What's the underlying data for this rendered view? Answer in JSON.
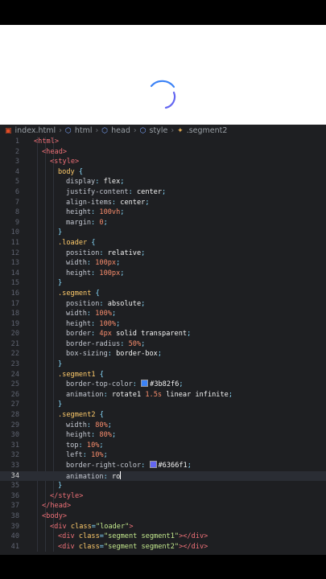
{
  "preview": {
    "spinner_color_1": "#3b82f6",
    "spinner_color_2": "#6366f1"
  },
  "breadcrumb": [
    {
      "label": "index.html",
      "icon": "html5-icon"
    },
    {
      "label": "html",
      "icon": "element-icon"
    },
    {
      "label": "head",
      "icon": "element-icon"
    },
    {
      "label": "style",
      "icon": "element-icon"
    },
    {
      "label": ".segment2",
      "icon": "css-rule-icon"
    }
  ],
  "active_line": 34,
  "lines": [
    {
      "n": "1",
      "code": [
        [
          "tag",
          "<html>"
        ]
      ],
      "indent": 0
    },
    {
      "n": "2",
      "code": [
        [
          "tag",
          "<head>"
        ]
      ],
      "indent": 1
    },
    {
      "n": "3",
      "code": [
        [
          "tag",
          "<style>"
        ]
      ],
      "indent": 2
    },
    {
      "n": "4",
      "code": [
        [
          "sel",
          "body "
        ],
        [
          "punc",
          "{"
        ]
      ],
      "indent": 3
    },
    {
      "n": "5",
      "code": [
        [
          "prop",
          "display"
        ],
        [
          "punc",
          ": "
        ],
        [
          "val",
          "flex"
        ],
        [
          "punc",
          ";"
        ]
      ],
      "indent": 4
    },
    {
      "n": "6",
      "code": [
        [
          "prop",
          "justify-content"
        ],
        [
          "punc",
          ": "
        ],
        [
          "val",
          "center"
        ],
        [
          "punc",
          ";"
        ]
      ],
      "indent": 4
    },
    {
      "n": "7",
      "code": [
        [
          "prop",
          "align-items"
        ],
        [
          "punc",
          ": "
        ],
        [
          "val",
          "center"
        ],
        [
          "punc",
          ";"
        ]
      ],
      "indent": 4
    },
    {
      "n": "8",
      "code": [
        [
          "prop",
          "height"
        ],
        [
          "punc",
          ": "
        ],
        [
          "num",
          "100vh"
        ],
        [
          "punc",
          ";"
        ]
      ],
      "indent": 4
    },
    {
      "n": "9",
      "code": [
        [
          "prop",
          "margin"
        ],
        [
          "punc",
          ": "
        ],
        [
          "num",
          "0"
        ],
        [
          "punc",
          ";"
        ]
      ],
      "indent": 4
    },
    {
      "n": "10",
      "code": [
        [
          "punc",
          "}"
        ]
      ],
      "indent": 3
    },
    {
      "n": "11",
      "code": [
        [
          "sel",
          ".loader "
        ],
        [
          "punc",
          "{"
        ]
      ],
      "indent": 3
    },
    {
      "n": "12",
      "code": [
        [
          "prop",
          "position"
        ],
        [
          "punc",
          ": "
        ],
        [
          "val",
          "relative"
        ],
        [
          "punc",
          ";"
        ]
      ],
      "indent": 4
    },
    {
      "n": "13",
      "code": [
        [
          "prop",
          "width"
        ],
        [
          "punc",
          ": "
        ],
        [
          "num",
          "100px"
        ],
        [
          "punc",
          ";"
        ]
      ],
      "indent": 4
    },
    {
      "n": "14",
      "code": [
        [
          "prop",
          "height"
        ],
        [
          "punc",
          ": "
        ],
        [
          "num",
          "100px"
        ],
        [
          "punc",
          ";"
        ]
      ],
      "indent": 4
    },
    {
      "n": "15",
      "code": [
        [
          "punc",
          "}"
        ]
      ],
      "indent": 3
    },
    {
      "n": "16",
      "code": [
        [
          "sel",
          ".segment "
        ],
        [
          "punc",
          "{"
        ]
      ],
      "indent": 3
    },
    {
      "n": "17",
      "code": [
        [
          "prop",
          "position"
        ],
        [
          "punc",
          ": "
        ],
        [
          "val",
          "absolute"
        ],
        [
          "punc",
          ";"
        ]
      ],
      "indent": 4
    },
    {
      "n": "18",
      "code": [
        [
          "prop",
          "width"
        ],
        [
          "punc",
          ": "
        ],
        [
          "num",
          "100%"
        ],
        [
          "punc",
          ";"
        ]
      ],
      "indent": 4
    },
    {
      "n": "19",
      "code": [
        [
          "prop",
          "height"
        ],
        [
          "punc",
          ": "
        ],
        [
          "num",
          "100%"
        ],
        [
          "punc",
          ";"
        ]
      ],
      "indent": 4
    },
    {
      "n": "20",
      "code": [
        [
          "prop",
          "border"
        ],
        [
          "punc",
          ": "
        ],
        [
          "num",
          "4px"
        ],
        [
          "val",
          " solid transparent"
        ],
        [
          "punc",
          ";"
        ]
      ],
      "indent": 4
    },
    {
      "n": "21",
      "code": [
        [
          "prop",
          "border-radius"
        ],
        [
          "punc",
          ": "
        ],
        [
          "num",
          "50%"
        ],
        [
          "punc",
          ";"
        ]
      ],
      "indent": 4
    },
    {
      "n": "22",
      "code": [
        [
          "prop",
          "box-sizing"
        ],
        [
          "punc",
          ": "
        ],
        [
          "val",
          "border-box"
        ],
        [
          "punc",
          ";"
        ]
      ],
      "indent": 4
    },
    {
      "n": "23",
      "code": [
        [
          "punc",
          "}"
        ]
      ],
      "indent": 3
    },
    {
      "n": "24",
      "code": [
        [
          "sel",
          ".segment1 "
        ],
        [
          "punc",
          "{"
        ]
      ],
      "indent": 3
    },
    {
      "n": "25",
      "code": [
        [
          "prop",
          "border-top-color"
        ],
        [
          "punc",
          ": "
        ],
        [
          "swatch",
          "#3b82f6"
        ],
        [
          "val",
          "#3b82f6"
        ],
        [
          "punc",
          ";"
        ]
      ],
      "indent": 4
    },
    {
      "n": "26",
      "code": [
        [
          "prop",
          "animation"
        ],
        [
          "punc",
          ": "
        ],
        [
          "val",
          "rotate1 "
        ],
        [
          "num",
          "1.5s"
        ],
        [
          "val",
          " linear infinite"
        ],
        [
          "punc",
          ";"
        ]
      ],
      "indent": 4
    },
    {
      "n": "27",
      "code": [
        [
          "punc",
          "}"
        ]
      ],
      "indent": 3
    },
    {
      "n": "28",
      "code": [
        [
          "sel",
          ".segment2 "
        ],
        [
          "punc",
          "{"
        ]
      ],
      "indent": 3
    },
    {
      "n": "29",
      "code": [
        [
          "prop",
          "width"
        ],
        [
          "punc",
          ": "
        ],
        [
          "num",
          "80%"
        ],
        [
          "punc",
          ";"
        ]
      ],
      "indent": 4
    },
    {
      "n": "30",
      "code": [
        [
          "prop",
          "height"
        ],
        [
          "punc",
          ": "
        ],
        [
          "num",
          "80%"
        ],
        [
          "punc",
          ";"
        ]
      ],
      "indent": 4
    },
    {
      "n": "31",
      "code": [
        [
          "prop",
          "top"
        ],
        [
          "punc",
          ": "
        ],
        [
          "num",
          "10%"
        ],
        [
          "punc",
          ";"
        ]
      ],
      "indent": 4
    },
    {
      "n": "32",
      "code": [
        [
          "prop",
          "left"
        ],
        [
          "punc",
          ": "
        ],
        [
          "num",
          "10%"
        ],
        [
          "punc",
          ";"
        ]
      ],
      "indent": 4
    },
    {
      "n": "33",
      "code": [
        [
          "prop",
          "border-right-color"
        ],
        [
          "punc",
          ": "
        ],
        [
          "swatch",
          "#6366f1"
        ],
        [
          "val",
          "#6366f1"
        ],
        [
          "punc",
          ";"
        ]
      ],
      "indent": 4
    },
    {
      "n": "34",
      "code": [
        [
          "prop",
          "animation"
        ],
        [
          "punc",
          ": "
        ],
        [
          "val",
          "ro"
        ],
        [
          "cursor",
          ""
        ]
      ],
      "indent": 4
    },
    {
      "n": "35",
      "code": [
        [
          "punc",
          "}"
        ]
      ],
      "indent": 3
    },
    {
      "n": "36",
      "code": [
        [
          "tag",
          "</style>"
        ]
      ],
      "indent": 2
    },
    {
      "n": "37",
      "code": [
        [
          "tag",
          "</head>"
        ]
      ],
      "indent": 1
    },
    {
      "n": "38",
      "code": [
        [
          "tag",
          "<body>"
        ]
      ],
      "indent": 1
    },
    {
      "n": "39",
      "code": [
        [
          "tag",
          "<div "
        ],
        [
          "attr",
          "class"
        ],
        [
          "punc",
          "="
        ],
        [
          "str",
          "\"loader\""
        ],
        [
          "tag",
          ">"
        ]
      ],
      "indent": 2
    },
    {
      "n": "40",
      "code": [
        [
          "tag",
          "<div "
        ],
        [
          "attr",
          "class"
        ],
        [
          "punc",
          "="
        ],
        [
          "str",
          "\"segment segment1\""
        ],
        [
          "tag",
          "></div>"
        ]
      ],
      "indent": 3
    },
    {
      "n": "41",
      "code": [
        [
          "tag",
          "<div "
        ],
        [
          "attr",
          "class"
        ],
        [
          "punc",
          "="
        ],
        [
          "str",
          "\"segment segment2\""
        ],
        [
          "tag",
          "></div>"
        ]
      ],
      "indent": 3
    }
  ]
}
